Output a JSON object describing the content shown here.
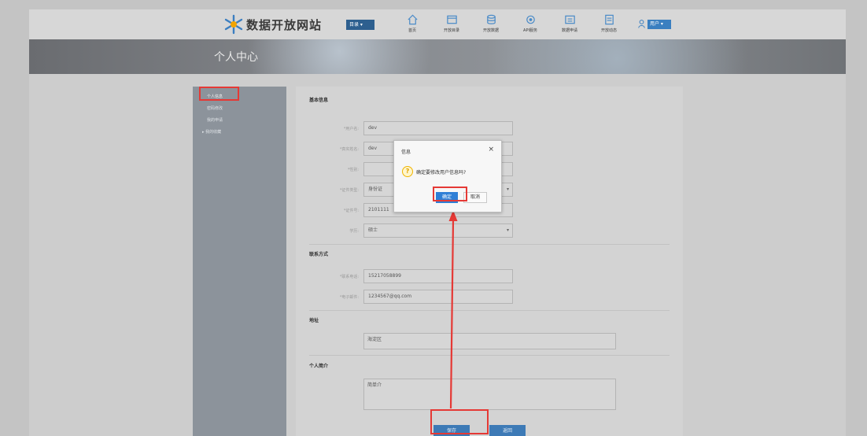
{
  "header": {
    "site_title": "数据开放网站",
    "category_button": "目录",
    "nav": [
      {
        "label": "首页",
        "icon": "home-icon"
      },
      {
        "label": "开放目录",
        "icon": "folder-icon"
      },
      {
        "label": "开放数据",
        "icon": "database-icon"
      },
      {
        "label": "API服务",
        "icon": "api-icon"
      },
      {
        "label": "数据申请",
        "icon": "apply-icon"
      },
      {
        "label": "开放动态",
        "icon": "news-icon"
      }
    ],
    "user_button": "用户"
  },
  "banner": {
    "title": "个人中心"
  },
  "sidebar": {
    "items": [
      {
        "label": "个人信息"
      },
      {
        "label": "密码修改"
      },
      {
        "label": "我的申请"
      },
      {
        "label": "▸ 我的收藏"
      }
    ]
  },
  "form": {
    "basic_section": "基本信息",
    "fields": [
      {
        "label": "*用户名:",
        "value": "dev"
      },
      {
        "label": "*真实姓名:",
        "value": "dev"
      },
      {
        "label": "*性别:",
        "value": ""
      },
      {
        "label": "*证件类型:",
        "value": "身份证"
      },
      {
        "label": "*证件号:",
        "value": "2101111"
      },
      {
        "label": "学历:",
        "value": "硕士"
      }
    ],
    "contact_section": "联系方式",
    "contact_fields": [
      {
        "label": "*联系电话:",
        "value": "15217058899"
      },
      {
        "label": "*电子邮件:",
        "value": "1234567@qq.com"
      }
    ],
    "address_section": "地址",
    "address_value": "海淀区",
    "intro_section": "个人简介",
    "intro_value": "简单介",
    "save_button": "保存",
    "back_button": "返回"
  },
  "dialog": {
    "title": "信息",
    "close": "×",
    "message": "确定要修改用户信息吗?",
    "ok": "确定",
    "cancel": "取消"
  },
  "colors": {
    "accent": "#3d7ab6",
    "highlight": "#e53935",
    "arrow": "#e53935"
  }
}
